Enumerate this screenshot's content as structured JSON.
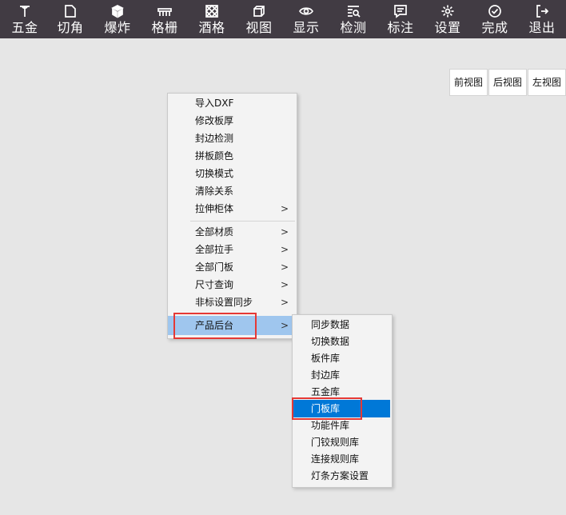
{
  "toolbar": {
    "items": [
      {
        "label": "五金",
        "icon": "screw-icon"
      },
      {
        "label": "切角",
        "icon": "cut-corner-icon"
      },
      {
        "label": "爆炸",
        "icon": "cube-explode-icon"
      },
      {
        "label": "格栅",
        "icon": "grille-icon"
      },
      {
        "label": "酒格",
        "icon": "wine-rack-icon"
      },
      {
        "label": "视图",
        "icon": "view-cube-icon"
      },
      {
        "label": "显示",
        "icon": "eye-icon"
      },
      {
        "label": "检测",
        "icon": "inspect-icon"
      },
      {
        "label": "标注",
        "icon": "annotation-icon"
      },
      {
        "label": "设置",
        "icon": "gear-icon"
      },
      {
        "label": "完成",
        "icon": "check-circle-icon"
      },
      {
        "label": "退出",
        "icon": "exit-icon"
      }
    ]
  },
  "views": [
    "前视图",
    "后视图",
    "左视图"
  ],
  "context_menu": {
    "items": [
      {
        "label": "导入DXF"
      },
      {
        "label": "修改板厚"
      },
      {
        "label": "封边检测"
      },
      {
        "label": "拼板颜色"
      },
      {
        "label": "切换模式"
      },
      {
        "label": "清除关系"
      },
      {
        "label": "拉伸柜体",
        "arrow": ">"
      },
      {
        "label": "全部材质",
        "arrow": ">"
      },
      {
        "label": "全部拉手",
        "arrow": ">"
      },
      {
        "label": "全部门板",
        "arrow": ">"
      },
      {
        "label": "尺寸查询",
        "arrow": ">"
      },
      {
        "label": "非标设置同步",
        "arrow": ">"
      },
      {
        "label": "产品后台",
        "arrow": ">"
      }
    ]
  },
  "submenu": {
    "items": [
      {
        "label": "同步数据"
      },
      {
        "label": "切换数据"
      },
      {
        "label": "板件库"
      },
      {
        "label": "封边库"
      },
      {
        "label": "五金库"
      },
      {
        "label": "门板库"
      },
      {
        "label": "功能件库"
      },
      {
        "label": "门铰规则库"
      },
      {
        "label": "连接规则库"
      },
      {
        "label": "灯条方案设置"
      }
    ]
  },
  "colors": {
    "toolbar_bg": "#413b43",
    "canvas_bg": "#e6e6e6",
    "highlight_light": "#9fc6ee",
    "highlight_selected": "#0078d7",
    "annotation_red": "#e53935"
  }
}
